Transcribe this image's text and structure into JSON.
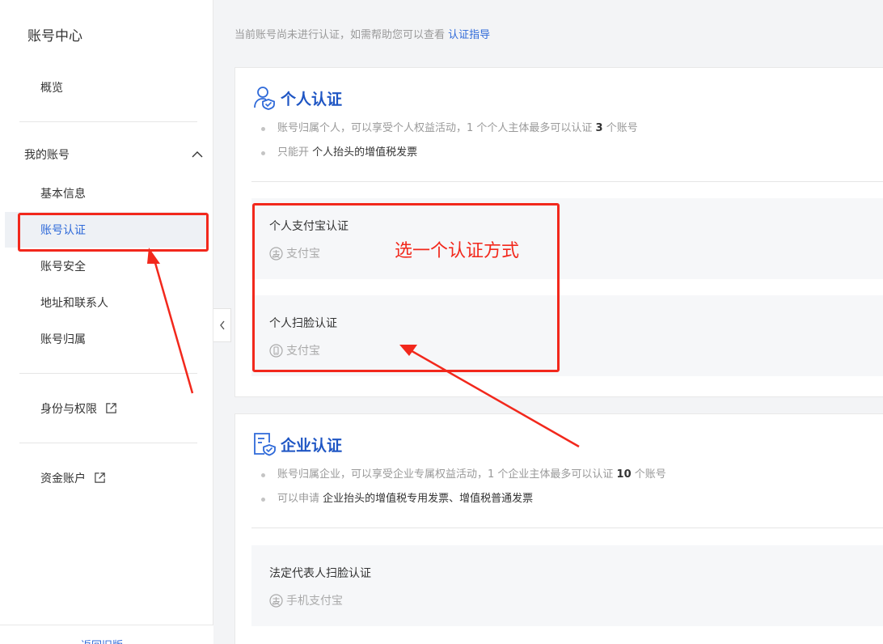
{
  "sidebar": {
    "title": "账号中心",
    "overview": "概览",
    "group_label": "我的账号",
    "items": [
      "基本信息",
      "账号认证",
      "账号安全",
      "地址和联系人",
      "账号归属"
    ],
    "identity": "身份与权限",
    "funds": "资金账户",
    "back": "返回旧版"
  },
  "notice": {
    "text": "当前账号尚未进行认证，如需帮助您可以查看 ",
    "link": "认证指导"
  },
  "personal": {
    "title": "个人认证",
    "bullet1_pre": "账号归属个人，可以享受个人权益活动，1 个个人主体最多可以认证 ",
    "bullet1_num": "3",
    "bullet1_post": " 个账号",
    "bullet2_pre": "只能开 ",
    "bullet2_em": "个人抬头的增值税发票",
    "methods": [
      {
        "title": "个人支付宝认证",
        "sub": "支付宝"
      },
      {
        "title": "个人扫脸认证",
        "sub": "支付宝"
      }
    ]
  },
  "enterprise": {
    "title": "企业认证",
    "bullet1_pre": "账号归属企业，可以享受企业专属权益活动，1 个企业主体最多可以认证 ",
    "bullet1_num": "10",
    "bullet1_post": " 个账号",
    "bullet2_pre": "可以申请 ",
    "bullet2_em": "企业抬头的增值税专用发票、增值税普通发票",
    "methods": [
      {
        "title": "法定代表人扫脸认证",
        "sub": "手机支付宝"
      }
    ]
  },
  "annotation": {
    "text": "选一个认证方式",
    "color": "#f2281c"
  },
  "colors": {
    "accent": "#2f6ad9",
    "heading": "#1f56c4"
  }
}
